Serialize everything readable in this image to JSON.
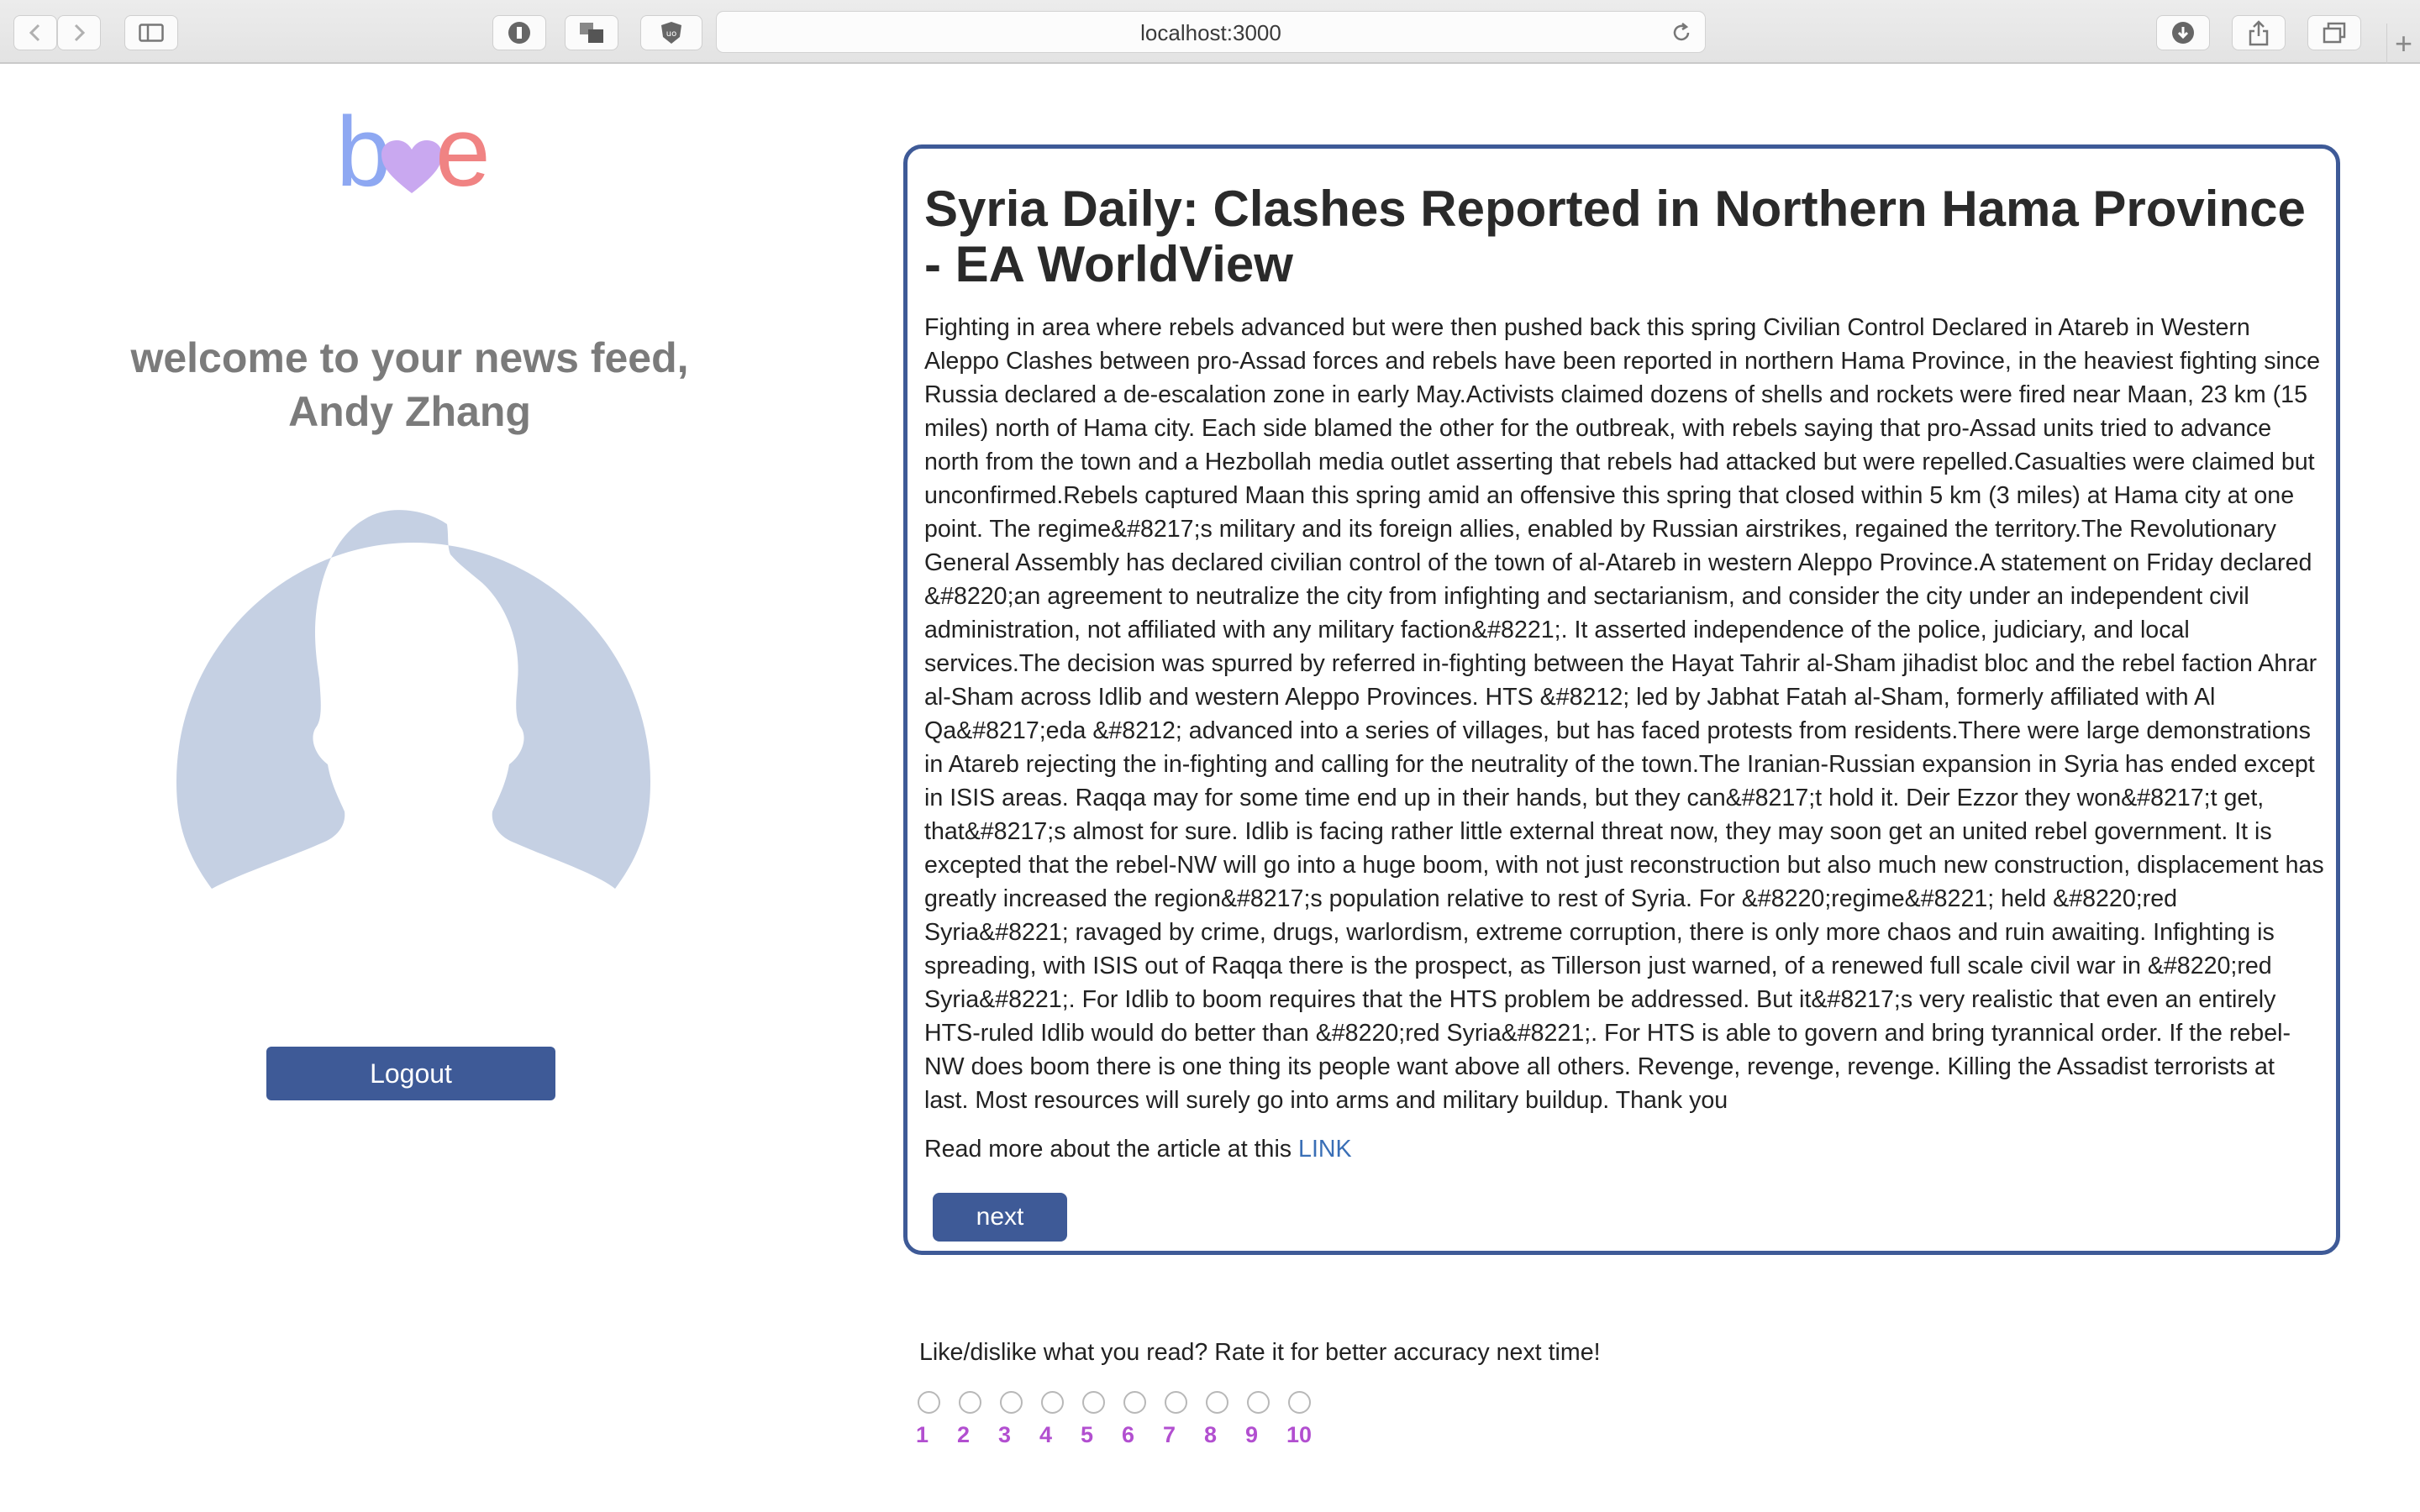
{
  "browser": {
    "url": "localhost:3000",
    "extension_badge": "3"
  },
  "logo": {
    "b": "b",
    "e": "e"
  },
  "welcome": {
    "line1": "welcome to your news feed,",
    "line2": "Andy Zhang"
  },
  "actions": {
    "logout_label": "Logout",
    "next_label": "next"
  },
  "article": {
    "title": "Syria Daily: Clashes Reported in Northern Hama Province - EA WorldView",
    "body": "Fighting in area where rebels advanced but were then pushed back this spring Civilian Control Declared in Atareb in Western Aleppo Clashes between pro-Assad forces and rebels have been reported in northern Hama Province, in the heaviest fighting since Russia declared a de-escalation zone in early May.Activists claimed dozens of shells and rockets were fired near Maan, 23 km (15 miles) north of Hama city. Each side blamed the other for the outbreak, with rebels saying that pro-Assad units tried to advance north from the town and a Hezbollah media outlet asserting that rebels had attacked but were repelled.Casualties were claimed but unconfirmed.Rebels captured Maan this spring amid an offensive this spring that closed within 5 km (3 miles) at Hama city at one point. The regime&#8217;s military and its foreign allies, enabled by Russian airstrikes, regained the territory.The Revolutionary General Assembly has declared civilian control of the town of al-Atareb in western Aleppo Province.A statement on Friday declared &#8220;an agreement to neutralize the city from infighting and sectarianism, and consider the city under an independent civil administration, not affiliated with any military faction&#8221;. It asserted independence of the police, judiciary, and local services.The decision was spurred by referred in-fighting between the Hayat Tahrir al-Sham jihadist bloc and the rebel faction Ahrar al-Sham across Idlib and western Aleppo Provinces. HTS &#8212; led by Jabhat Fatah al-Sham, formerly affiliated with Al Qa&#8217;eda &#8212; advanced into a series of villages, but has faced protests from residents.There were large demonstrations in Atareb rejecting the in-fighting and calling for the neutrality of the town.The Iranian-Russian expansion in Syria has ended except in ISIS areas. Raqqa may for some time end up in their hands, but they can&#8217;t hold it. Deir Ezzor they won&#8217;t get, that&#8217;s almost for sure. Idlib is facing rather little external threat now, they may soon get an united rebel government. It is excepted that the rebel-NW will go into a huge boom, with not just reconstruction but also much new construction, displacement has greatly increased the region&#8217;s population relative to rest of Syria. For &#8220;regime&#8221; held &#8220;red Syria&#8221; ravaged by crime, drugs, warlordism, extreme corruption, there is only more chaos and ruin awaiting. Infighting is spreading, with ISIS out of Raqqa there is the prospect, as Tillerson just warned, of a renewed full scale civil war in &#8220;red Syria&#8221;. For Idlib to boom requires that the HTS problem be addressed. But it&#8217;s very realistic that even an entirely HTS-ruled Idlib would do better than &#8220;red Syria&#8221;. For HTS is able to govern and bring tyrannical order. If the rebel-NW does boom there is one thing its people want above all others. Revenge, revenge, revenge. Killing the Assadist terrorists at last. Most resources will surely go into arms and military buildup. Thank you",
    "read_more_prefix": "Read more about the article at this",
    "read_more_link": "LINK"
  },
  "rating": {
    "prompt": "Like/dislike what you read? Rate it for better accuracy next time!",
    "options": [
      "1",
      "2",
      "3",
      "4",
      "5",
      "6",
      "7",
      "8",
      "9",
      "10"
    ]
  },
  "colors": {
    "brand": "#3e5a97",
    "logo_b": "#8ea8f2",
    "logo_heart": "#c9a8f0",
    "logo_e": "#f08383",
    "avatar": "#c5d0e3",
    "rating_number": "#b24fd0",
    "link": "#3a6fb6"
  }
}
